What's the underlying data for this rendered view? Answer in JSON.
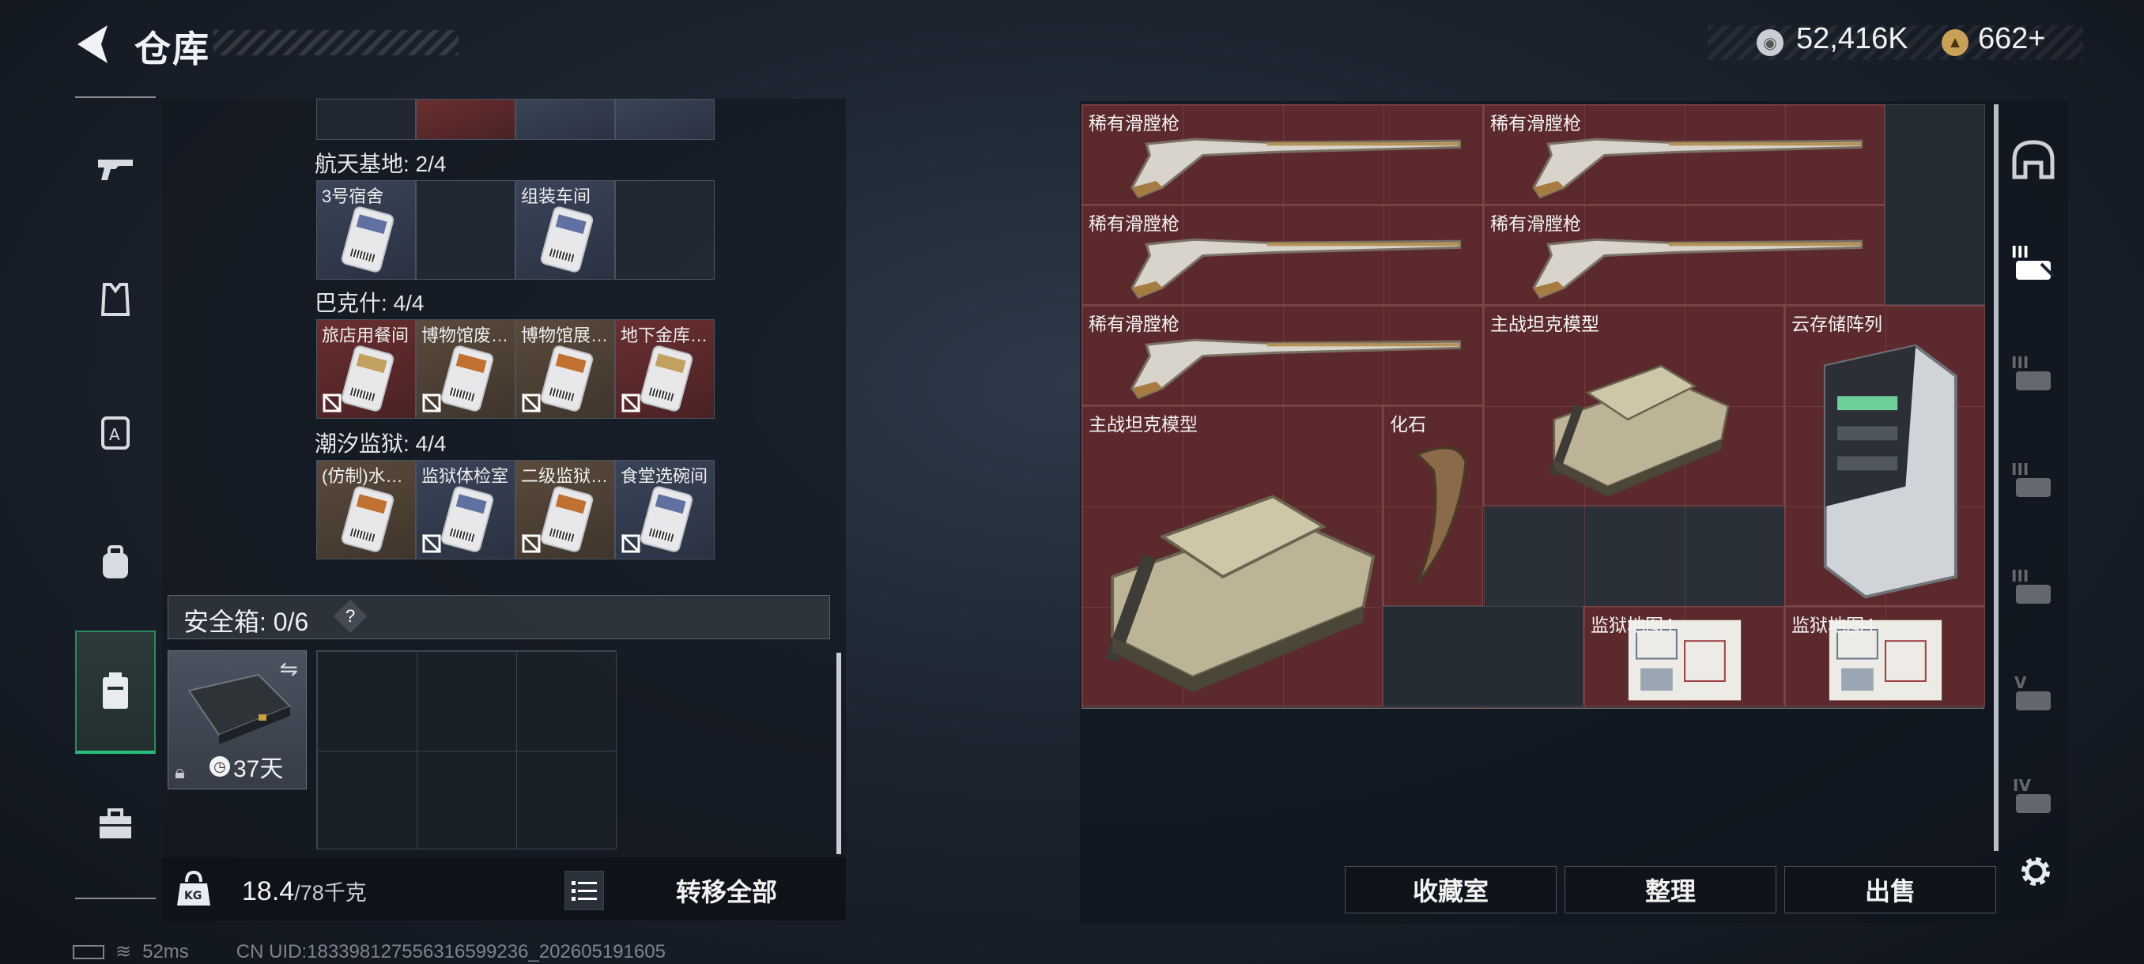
{
  "header": {
    "title": "仓库"
  },
  "currency": {
    "silver": "52,416K",
    "gold": "662+"
  },
  "left_panel": {
    "groups": [
      {
        "label": "航天基地: 2/4",
        "slots": [
          {
            "label": "3号宿舍",
            "style": "blue",
            "card": true,
            "locked": false
          },
          {
            "label": "",
            "style": "empty",
            "card": false,
            "locked": false
          },
          {
            "label": "组装车间",
            "style": "blue",
            "card": true,
            "locked": false
          },
          {
            "label": "",
            "style": "empty",
            "card": false,
            "locked": false
          }
        ]
      },
      {
        "label": "巴克什: 4/4",
        "slots": [
          {
            "label": "旅店用餐间",
            "style": "red",
            "card": true,
            "locked": true
          },
          {
            "label": "博物馆废…",
            "style": "brown",
            "card": true,
            "locked": true
          },
          {
            "label": "博物馆展…",
            "style": "brown",
            "card": true,
            "locked": true
          },
          {
            "label": "地下金库…",
            "style": "red",
            "card": true,
            "locked": true
          }
        ]
      },
      {
        "label": "潮汐监狱: 4/4",
        "slots": [
          {
            "label": "(仿制)水…",
            "style": "brown",
            "card": true,
            "locked": false
          },
          {
            "label": "监狱体检室",
            "style": "blue",
            "card": true,
            "locked": true
          },
          {
            "label": "二级监狱…",
            "style": "brown",
            "card": true,
            "locked": true
          },
          {
            "label": "食堂选碗间",
            "style": "blue",
            "card": true,
            "locked": true
          }
        ]
      }
    ],
    "safe_box": {
      "label": "安全箱: 0/6",
      "help": "?",
      "days": "37天"
    },
    "weight": {
      "current": "18.4",
      "max": "/78千克"
    },
    "transfer_all": "转移全部"
  },
  "status": {
    "ping": "52ms",
    "uid": "CN UID:1833981275563165992​36_202605191605"
  },
  "inventory": {
    "items": [
      {
        "label": "稀有滑膛枪",
        "kind": "gun"
      },
      {
        "label": "稀有滑膛枪",
        "kind": "gun"
      },
      {
        "label": "稀有滑膛枪",
        "kind": "gun"
      },
      {
        "label": "稀有滑膛枪",
        "kind": "gun"
      },
      {
        "label": "稀有滑膛枪",
        "kind": "gun"
      },
      {
        "label": "主战坦克模型",
        "kind": "tank"
      },
      {
        "label": "云存储阵列",
        "kind": "server"
      },
      {
        "label": "主战坦克模型",
        "kind": "tank"
      },
      {
        "label": "化石",
        "kind": "fossil"
      },
      {
        "label": "监狱地图4",
        "kind": "map"
      },
      {
        "label": "监狱地图4",
        "kind": "map"
      }
    ]
  },
  "actions": {
    "collection": "收藏室",
    "sort": "整理",
    "sell": "出售"
  },
  "side_tabs": [
    "helmet-tab",
    "tier-3-tab-active",
    "tier-3-tab-b",
    "tier-3-tab-c",
    "tier-3-tab-d",
    "tier-5-tab",
    "tier-4-tab"
  ],
  "colors": {
    "accent_green": "#27c07a",
    "item_red": "#5c2a2c"
  }
}
